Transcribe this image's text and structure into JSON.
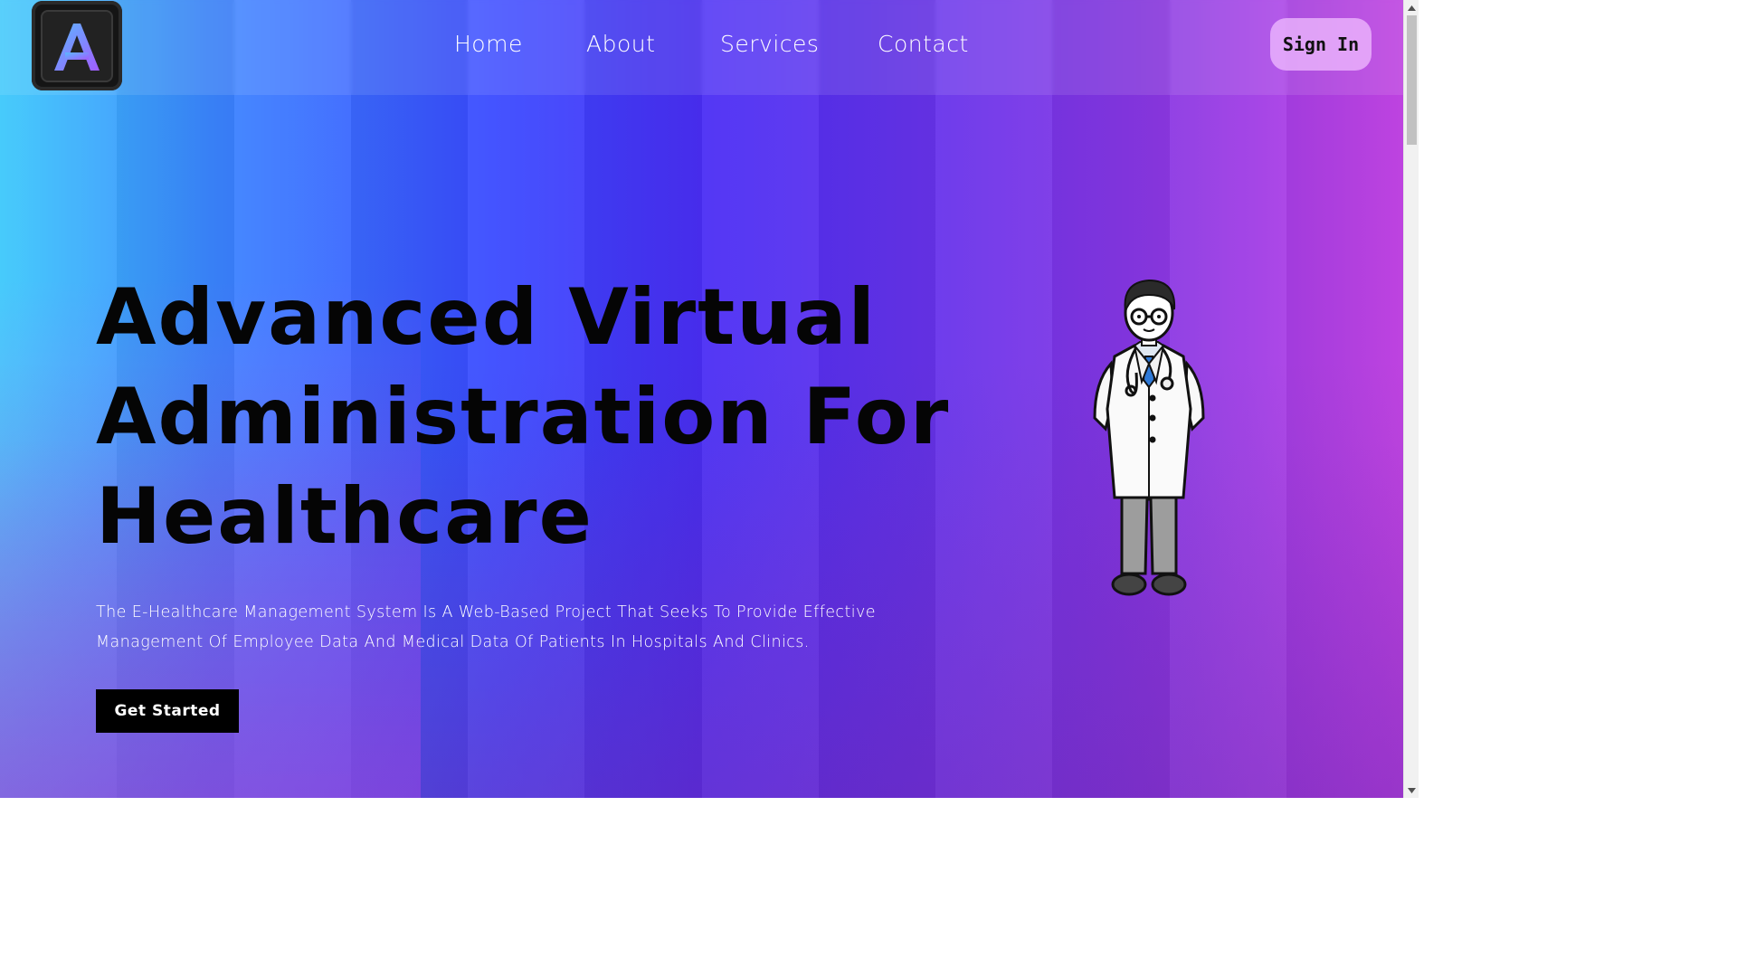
{
  "brand": {
    "logo_letter": "A",
    "logo_icon": "letter-a-logo-icon"
  },
  "nav": {
    "items": [
      {
        "label": "Home"
      },
      {
        "label": "About"
      },
      {
        "label": "Services"
      },
      {
        "label": "Contact"
      }
    ],
    "signin_label": "Sign In"
  },
  "hero": {
    "title": "Advanced Virtual Administration For Healthcare",
    "description": "The E-Healthcare Management System Is A Web-Based Project That Seeks To Provide Effective Management Of Employee Data And Medical Data Of Patients In Hospitals And Clinics.",
    "cta_label": "Get Started",
    "illustration": "doctor-illustration"
  },
  "colors": {
    "gradient_start": "#3ec9fb",
    "gradient_mid": "#3a4bff",
    "gradient_end": "#c646ea",
    "text_dark": "#050505",
    "cta_bg": "#000000",
    "signin_bg": "#f0beff"
  }
}
